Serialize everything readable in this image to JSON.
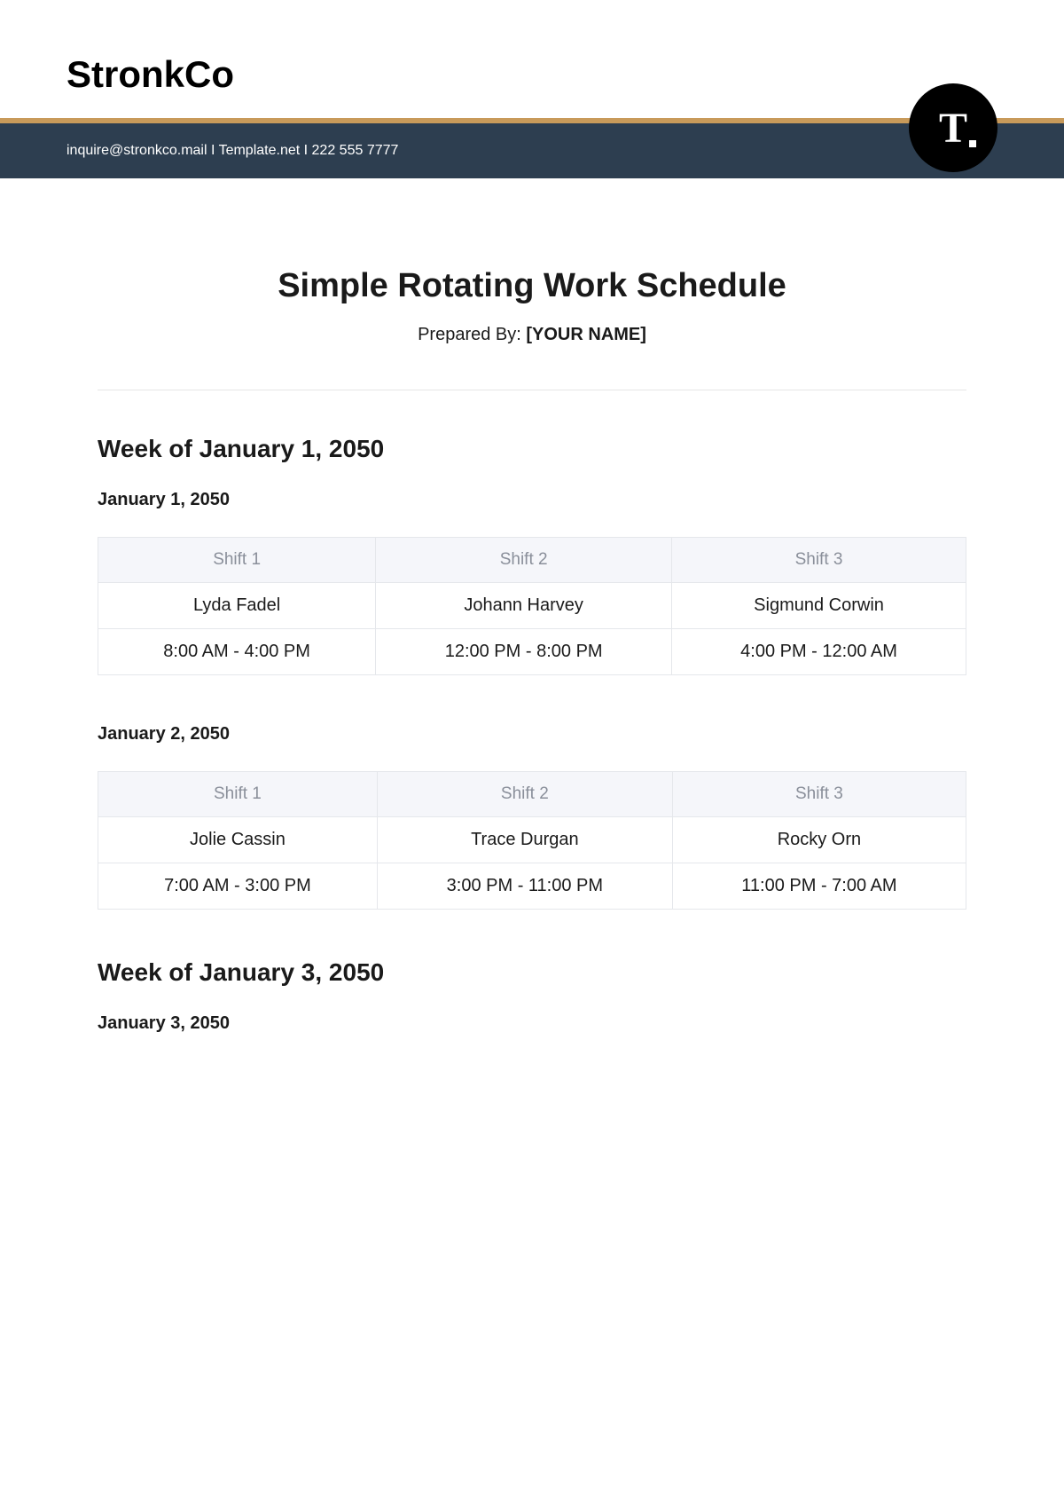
{
  "company": {
    "name": "StronkCo",
    "email": "inquire@stronkco.mail",
    "website": "Template.net",
    "phone": "222 555 7777",
    "logo_text": "T"
  },
  "document": {
    "title": "Simple Rotating Work Schedule",
    "prepared_by_label": "Prepared By: ",
    "prepared_by_value": "[YOUR NAME]"
  },
  "separator": "  I  ",
  "weeks": [
    {
      "heading": "Week of January 1, 2050",
      "days": [
        {
          "date": "January 1, 2050",
          "shifts": {
            "headers": [
              "Shift 1",
              "Shift 2",
              "Shift 3"
            ],
            "names": [
              "Lyda Fadel",
              "Johann Harvey",
              "Sigmund Corwin"
            ],
            "times": [
              "8:00 AM - 4:00 PM",
              "12:00 PM - 8:00 PM",
              "4:00 PM - 12:00 AM"
            ]
          }
        },
        {
          "date": "January 2, 2050",
          "shifts": {
            "headers": [
              "Shift 1",
              "Shift 2",
              "Shift 3"
            ],
            "names": [
              "Jolie Cassin",
              "Trace Durgan",
              "Rocky Orn"
            ],
            "times": [
              "7:00 AM - 3:00 PM",
              "3:00 PM - 11:00 PM",
              "11:00 PM - 7:00 AM"
            ]
          }
        }
      ]
    },
    {
      "heading": "Week of January 3, 2050",
      "days": [
        {
          "date": "January 3, 2050",
          "shifts": null
        }
      ]
    }
  ]
}
